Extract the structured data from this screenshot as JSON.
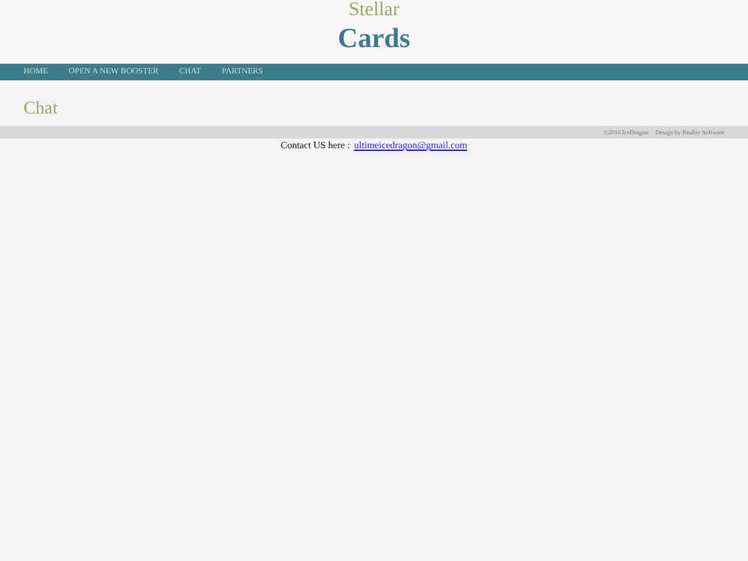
{
  "header": {
    "subtitle": "Stellar",
    "title": "Cards"
  },
  "nav": [
    {
      "label": "HOME"
    },
    {
      "label": "OPEN A NEW BOOSTER"
    },
    {
      "label": "CHAT"
    },
    {
      "label": "PARTNERS"
    }
  ],
  "page": {
    "heading": "Chat"
  },
  "footer": {
    "copyright": "©2016 IceDragon",
    "credit": "Design by Reality Software"
  },
  "contact": {
    "label": "Contact US here :",
    "email": "ultimeicedragon@gmail.com"
  }
}
